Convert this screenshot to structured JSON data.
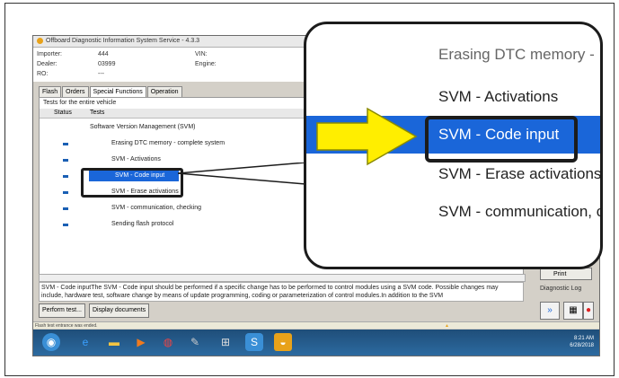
{
  "window": {
    "title": "Offboard Diagnostic Information System Service - 4.3.3",
    "info": {
      "importer_label": "Importer:",
      "importer_value": "444",
      "dealer_label": "Dealer:",
      "dealer_value": "03999",
      "ro_label": "RO:",
      "ro_value": "---",
      "vin_label": "VIN:",
      "engine_label": "Engine:"
    },
    "tabs": [
      "Flash",
      "Orders",
      "Special Functions",
      "Operation"
    ],
    "section_title": "Tests for the entire vehicle",
    "columns": {
      "status": "Status",
      "tests": "Tests"
    },
    "group_label": "Software Version Management (SVM)",
    "tests": [
      "Erasing DTC memory - complete system",
      "SVM - Activations",
      "SVM - Code input",
      "SVM - Erase activations",
      "SVM - communication, checking",
      "Sending flash protocol"
    ],
    "selected_index": 2,
    "description": "SVM - Code inputThe SVM - Code input should be performed if a specific change has to be performed to control modules using a SVM code. Possible changes may include, hardware test, software change by means of update programming, coding or parameterization of control modules.In addition to the SVM",
    "buttons": {
      "perform_test": "Perform test...",
      "display_documents": "Display documents",
      "print": "Print"
    },
    "diagnostic_log": "Diagnostic Log",
    "status_text": "Flash test entrance was ended.",
    "clock": {
      "time": "8:21 AM",
      "date": "6/28/2018"
    }
  },
  "zoom": {
    "items": [
      "Erasing DTC memory -",
      "SVM - Activations",
      "SVM - Code input",
      "SVM - Erase activations",
      "SVM - communication, c"
    ],
    "selected_index": 2
  },
  "colors": {
    "selection": "#1a66d9",
    "arrow": "#ffee00",
    "callout_border": "#1c1c1c"
  },
  "icons": [
    "start-orb-icon",
    "ie-icon",
    "folder-icon",
    "media-icon",
    "chrome-icon",
    "tools-icon",
    "windows-icon",
    "s-app-icon",
    "odis-icon"
  ]
}
